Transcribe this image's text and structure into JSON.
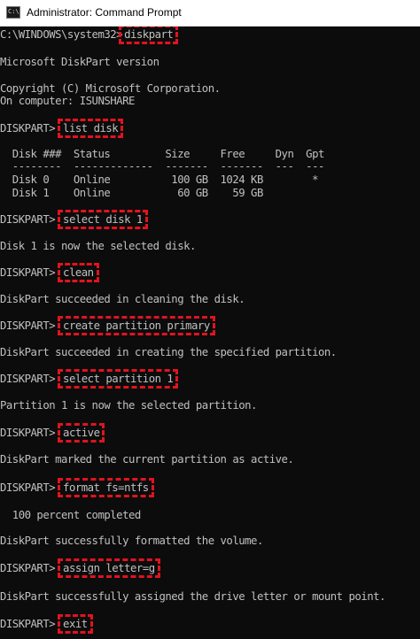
{
  "window": {
    "title": "Administrator: Command Prompt",
    "icon": "cmd-icon"
  },
  "console": {
    "accent_color": "#e0141e",
    "lines": [
      {
        "prompt": "C:\\WINDOWS\\system32>",
        "command": "diskpart"
      },
      {
        "text": "Microsoft DiskPart version"
      },
      {
        "text": "Copyright (C) Microsoft Corporation."
      },
      {
        "text": "On computer: ISUNSHARE"
      },
      {
        "prompt": "DISKPART> ",
        "command": "list disk"
      },
      {
        "text": "  Disk ###  Status         Size     Free     Dyn  Gpt"
      },
      {
        "text": "  --------  -------------  -------  -------  ---  ---"
      },
      {
        "text": "  Disk 0    Online          100 GB  1024 KB        *"
      },
      {
        "text": "  Disk 1    Online           60 GB    59 GB"
      },
      {
        "prompt": "DISKPART> ",
        "command": "select disk 1"
      },
      {
        "text": "Disk 1 is now the selected disk."
      },
      {
        "prompt": "DISKPART> ",
        "command": "clean"
      },
      {
        "text": "DiskPart succeeded in cleaning the disk."
      },
      {
        "prompt": "DISKPART> ",
        "command": "create partition primary"
      },
      {
        "text": "DiskPart succeeded in creating the specified partition."
      },
      {
        "prompt": "DISKPART> ",
        "command": "select partition 1"
      },
      {
        "text": "Partition 1 is now the selected partition."
      },
      {
        "prompt": "DISKPART> ",
        "command": "active"
      },
      {
        "text": "DiskPart marked the current partition as active."
      },
      {
        "prompt": "DISKPART> ",
        "command": "format fs=ntfs"
      },
      {
        "text": "  100 percent completed"
      },
      {
        "text": "DiskPart successfully formatted the volume."
      },
      {
        "prompt": "DISKPART> ",
        "command": "assign letter=g"
      },
      {
        "text": "DiskPart successfully assigned the drive letter or mount point."
      },
      {
        "prompt": "DISKPART> ",
        "command": "exit"
      }
    ]
  }
}
